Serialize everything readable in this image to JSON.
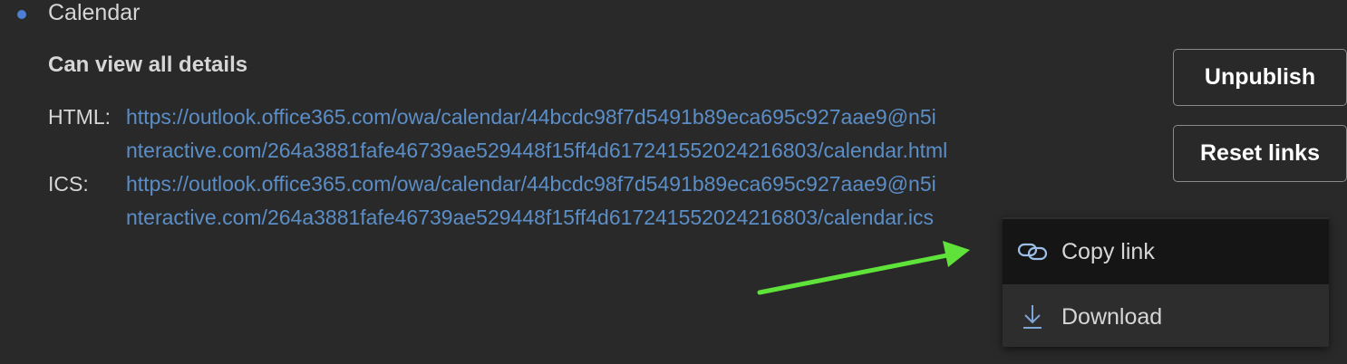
{
  "calendar": {
    "name": "Calendar",
    "permission": "Can view all details"
  },
  "links": {
    "html_label": "HTML:",
    "html_url_line1": "https://outlook.office365.com/owa/calendar/44bcdc98f7d5491b89eca695c927aae9@n5i",
    "html_url_line2": "nteractive.com/264a3881fafe46739ae529448f15ff4d617241552024216803/calendar.html",
    "ics_label": "ICS:",
    "ics_url_line1": "https://outlook.office365.com/owa/calendar/44bcdc98f7d5491b89eca695c927aae9@n5i",
    "ics_url_line2": "nteractive.com/264a3881fafe46739ae529448f15ff4d617241552024216803/calendar.ics"
  },
  "buttons": {
    "unpublish": "Unpublish",
    "reset_links": "Reset links"
  },
  "context_menu": {
    "items": [
      {
        "label": "Copy link",
        "icon": "link-icon"
      },
      {
        "label": "Download",
        "icon": "download-icon"
      }
    ]
  },
  "colors": {
    "background": "#292929",
    "link": "#5b8ec7",
    "bullet": "#4a7fd4",
    "annotation_arrow": "#5fe23a"
  }
}
